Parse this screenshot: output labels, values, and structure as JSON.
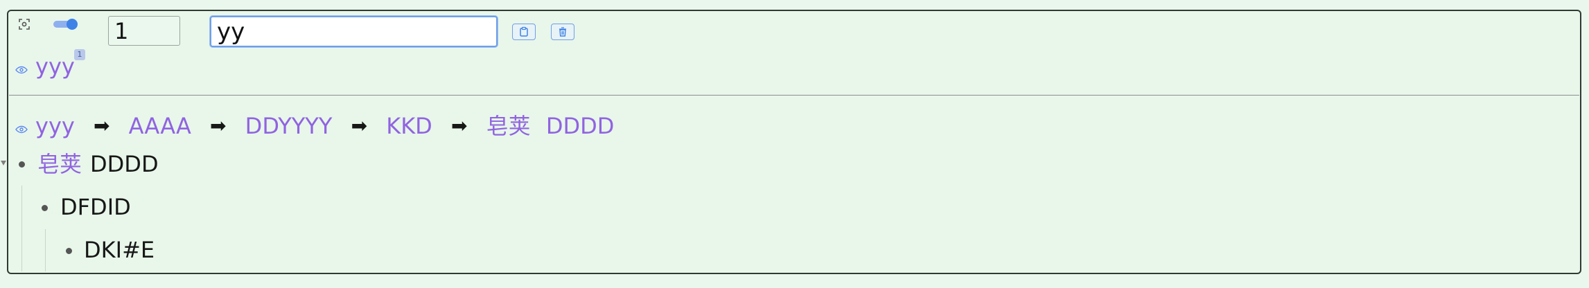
{
  "controls": {
    "number_value": "1",
    "text_value": "yy"
  },
  "top_item": {
    "label": "yyy",
    "badge": "1"
  },
  "path": {
    "segments": [
      "yyy",
      "AAAA",
      "DDYYYY",
      "KKD"
    ],
    "final_prefix": "皂荚",
    "final_suffix": "DDDD",
    "arrow": "➡"
  },
  "tree": {
    "root_prefix": "皂荚",
    "root_suffix": "DDDD",
    "child": "DFDID",
    "grandchild": "DKI#E"
  },
  "colors": {
    "accent_blue": "#3f82e7",
    "purple_text": "#9163e1",
    "background": "#e8f7ea"
  },
  "icons": {
    "fit": "fit-screen-icon",
    "toggle": "toggle-icon",
    "view": "eye-icon",
    "copy": "clipboard-icon",
    "delete": "trash-icon",
    "expand": "triangle-down-icon"
  }
}
